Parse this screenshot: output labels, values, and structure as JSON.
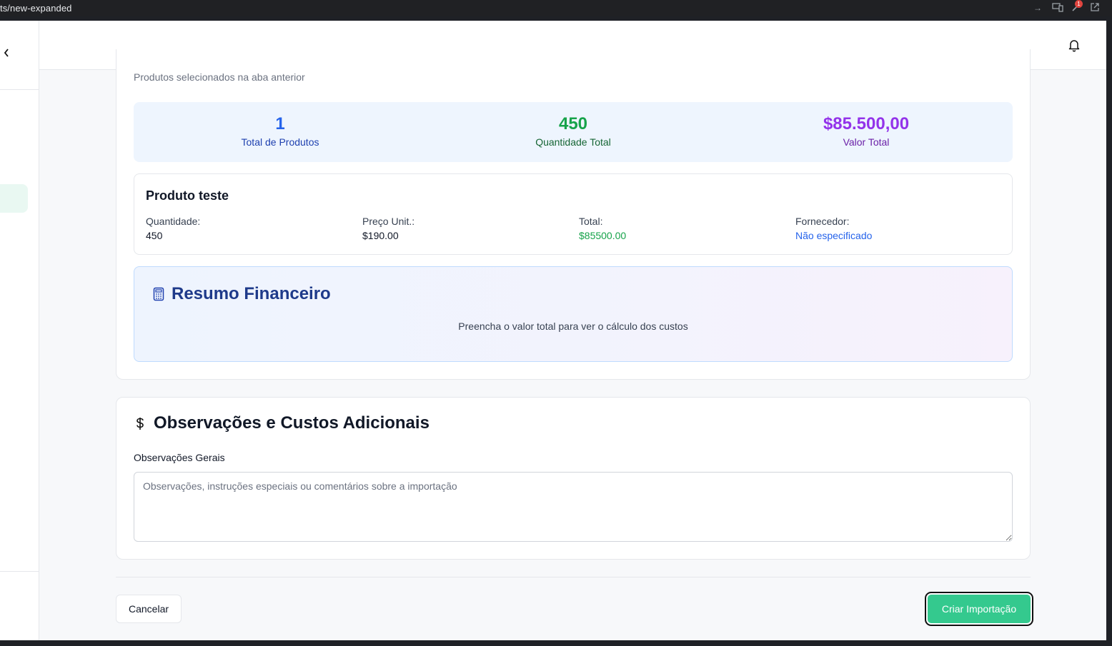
{
  "browser": {
    "url_fragment": "ts/new-expanded",
    "notification_count": "1"
  },
  "sidebar": {
    "collapse_icon": "chevron-left-icon"
  },
  "topbar": {
    "bell_icon": "bell-icon"
  },
  "products_card": {
    "subtitle": "Produtos selecionados na aba anterior",
    "stats": [
      {
        "value": "1",
        "label": "Total de Produtos",
        "color": "#2563eb",
        "label_color": "#1e40af"
      },
      {
        "value": "450",
        "label": "Quantidade Total",
        "color": "#16a34a",
        "label_color": "#166534"
      },
      {
        "value": "$85.500,00",
        "label": "Valor Total",
        "color": "#9333ea",
        "label_color": "#6b21a8"
      }
    ],
    "product": {
      "name": "Produto teste",
      "fields": [
        {
          "key": "Quantidade:",
          "value": "450",
          "color": "#111827"
        },
        {
          "key": "Preço Unit.:",
          "value": "$190.00",
          "color": "#111827"
        },
        {
          "key": "Total:",
          "value": "$85500.00",
          "color": "#16a34a"
        },
        {
          "key": "Fornecedor:",
          "value": "Não especificado",
          "color": "#2563eb"
        }
      ]
    },
    "finance": {
      "title": "Resumo Financeiro",
      "icon": "calculator-icon",
      "message": "Preencha o valor total para ver o cálculo dos custos"
    }
  },
  "observations": {
    "title": "Observações e Custos Adicionais",
    "icon": "dollar-icon",
    "label": "Observações Gerais",
    "placeholder": "Observações, instruções especiais ou comentários sobre a importação",
    "value": ""
  },
  "footer": {
    "cancel_label": "Cancelar",
    "submit_label": "Criar Importação",
    "submit_color": "#34c98e"
  }
}
